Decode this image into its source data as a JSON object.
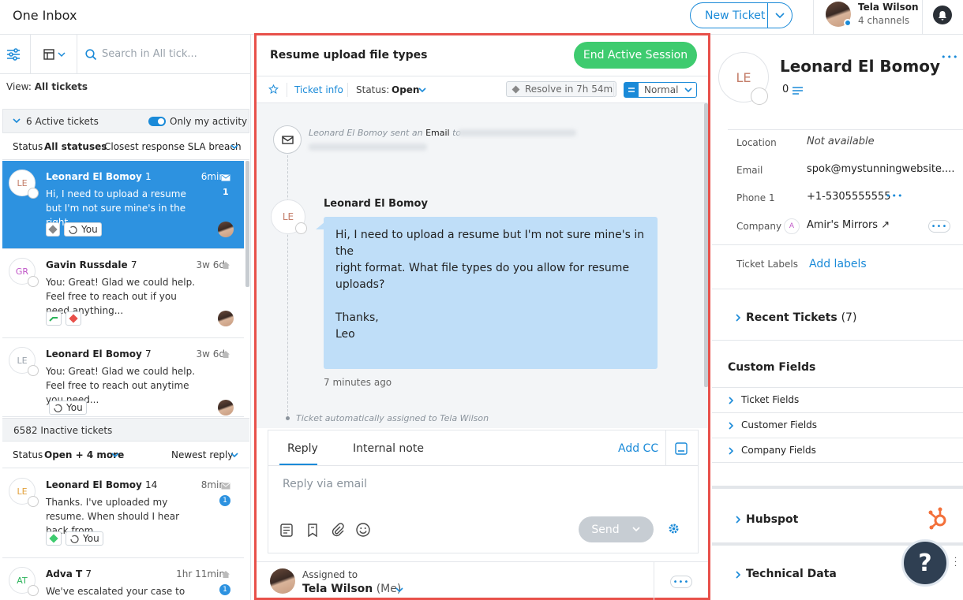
{
  "header": {
    "app_title": "One Inbox",
    "new_ticket_label": "New Ticket",
    "user_name": "Tela Wilson",
    "user_channels": "4 channels"
  },
  "left": {
    "search_placeholder": "Search in All tick...",
    "view_label": "View:",
    "view_value": "All tickets",
    "active_group": "6 Active tickets",
    "only_my_activity": "Only my activity",
    "status_label": "Status",
    "status_value": "All statuses",
    "sort_active": "Closest response SLA breach",
    "inactive_group": "6582 Inactive tickets",
    "status_value_inactive": "Open + 4 more",
    "sort_inactive": "Newest reply",
    "tickets": [
      {
        "initials": "LE",
        "name": "Leonard El Bomoy",
        "count": "1",
        "time": "6min",
        "text": "Hi, I need to upload a resume but I'm not sure mine's in the right...",
        "badge": "1",
        "chip": "You"
      },
      {
        "initials": "GR",
        "name": "Gavin Russdale",
        "count": "7",
        "time": "3w 6d",
        "text": "You: Great! Glad we could help. Feel free to reach out if you need anything..."
      },
      {
        "initials": "LE",
        "name": "Leonard El Bomoy",
        "count": "7",
        "time": "3w 6d",
        "text": "You: Great! Glad we could help. Feel free to reach out anytime you need...",
        "chip": "You"
      },
      {
        "initials": "LE",
        "name": "Leonard El Bomoy",
        "count": "14",
        "time": "8min",
        "text": "Thanks. I've uploaded my resume. When should I hear back from...",
        "badge": "1",
        "chip": "You"
      },
      {
        "initials": "AT",
        "name": "Adva T",
        "count": "7",
        "time": "1hr 11min",
        "text": "We've escalated your case to our",
        "badge": "1"
      }
    ]
  },
  "center": {
    "title": "Resume upload file types",
    "end_session": "End Active Session",
    "ticket_info": "Ticket info",
    "status_label": "Status:",
    "status_value": "Open",
    "resolve_in": "Resolve in 7h 54m",
    "priority": "Normal",
    "event_prefix": "Leonard El Bomoy sent an",
    "event_channel": "Email",
    "event_to": "to",
    "sender_initials": "LE",
    "sender_name": "Leonard El Bomoy",
    "message_lines": [
      "Hi, I need to upload a resume but I'm not sure mine's in the",
      "right format. What file types do you allow for resume",
      "uploads?",
      "",
      "Thanks,",
      "Leo"
    ],
    "message_time": "7 minutes ago",
    "auto_assign": "Ticket automatically assigned to Tela Wilson",
    "tab_reply": "Reply",
    "tab_internal": "Internal note",
    "add_cc": "Add CC",
    "reply_placeholder": "Reply via email",
    "send": "Send",
    "assigned_to_label": "Assigned to",
    "assignee": "Tela Wilson",
    "assignee_me": "(Me)"
  },
  "right": {
    "initials": "LE",
    "customer_name": "Leonard El Bomoy",
    "count": "0",
    "fields": [
      {
        "label": "Location",
        "value": "Not available"
      },
      {
        "label": "Email",
        "value": "spok@mystunningwebsite...."
      },
      {
        "label": "Phone 1",
        "value": "+1-5305555555"
      },
      {
        "label": "Company",
        "value": "Amir's Mirrors ↗"
      }
    ],
    "company_initial": "A",
    "ticket_labels": "Ticket Labels",
    "add_labels": "Add labels",
    "recent_tickets": "Recent Tickets",
    "recent_count": "(7)",
    "custom_fields": "Custom Fields",
    "custom_items": [
      "Ticket Fields",
      "Customer Fields",
      "Company Fields"
    ],
    "hubspot": "Hubspot",
    "technical_data": "Technical Data",
    "help": "?"
  },
  "colors": {
    "accent": "#1a8ad8",
    "selected": "#2d92e0",
    "green": "#3ecb6f",
    "highlight": "#e8504a",
    "bubble": "#bfdef8"
  }
}
